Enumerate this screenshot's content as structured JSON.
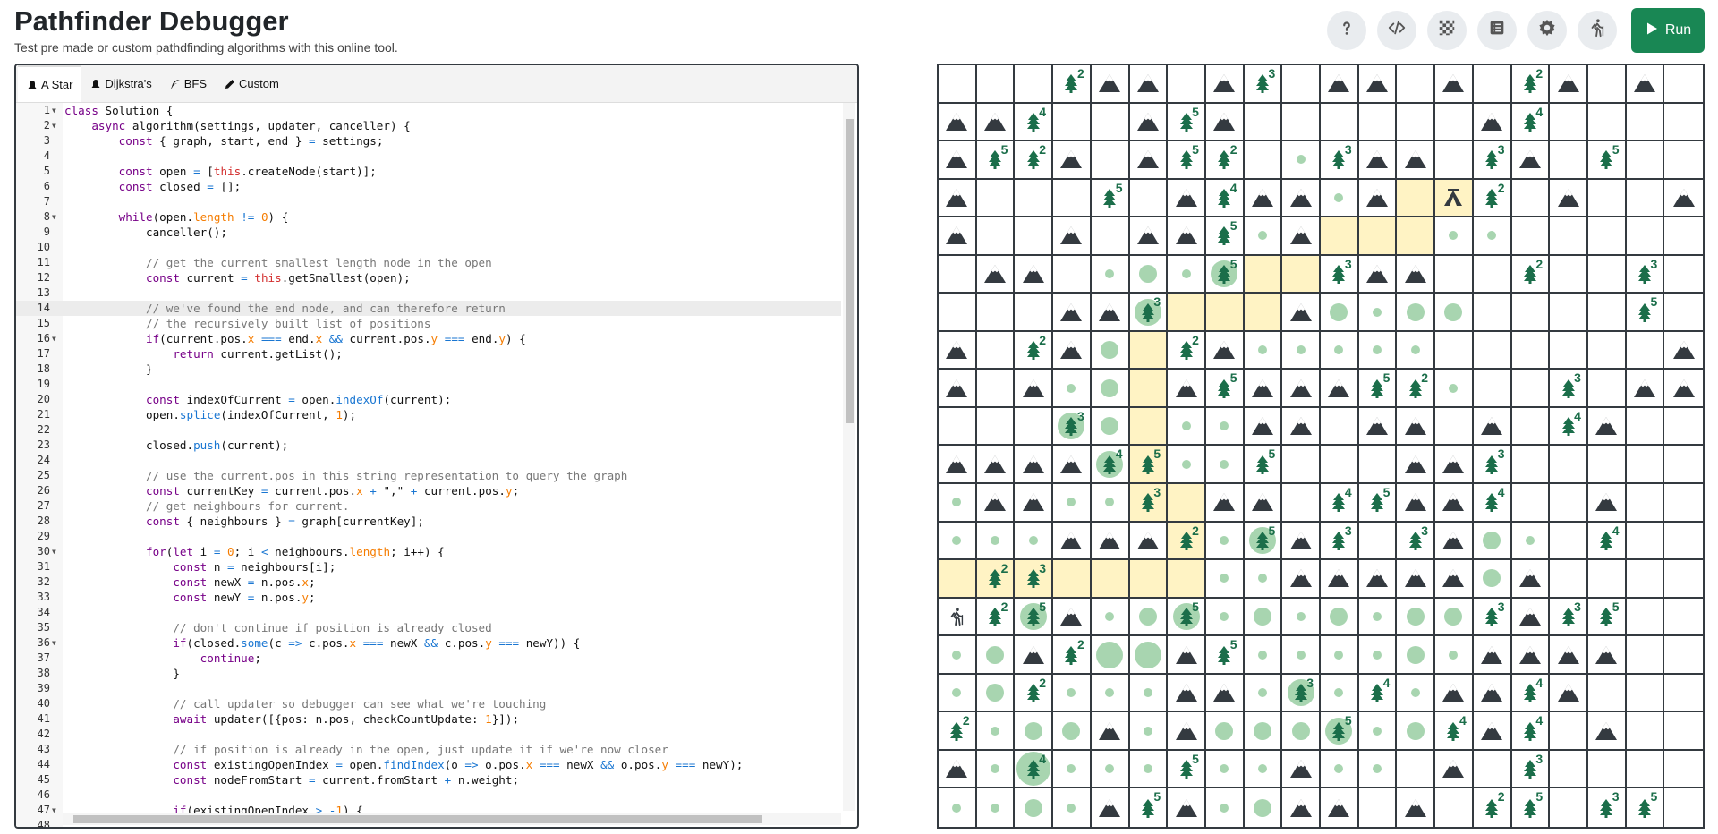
{
  "header": {
    "title": "Pathfinder Debugger",
    "subtitle": "Test pre made or custom pathdfinding algorithms with this online tool."
  },
  "toolbar": {
    "buttons": [
      "help-icon",
      "code-settings-icon",
      "grid-pattern-icon",
      "table-icon",
      "gear-icon",
      "hiker-icon"
    ],
    "run_label": "Run"
  },
  "tabs": [
    {
      "label": "A Star",
      "icon": "bell-icon",
      "active": true
    },
    {
      "label": "Dijkstra's",
      "icon": "bell-icon",
      "active": false
    },
    {
      "label": "BFS",
      "icon": "feather-icon",
      "active": false
    },
    {
      "label": "Custom",
      "icon": "pencil-icon",
      "active": false
    }
  ],
  "editor": {
    "current_line": 14,
    "folded_lines": [
      1,
      2,
      8,
      16,
      30,
      36,
      47
    ],
    "lines": [
      "class Solution {",
      "    async algorithm(settings, updater, canceller) {",
      "        const { graph, start, end } = settings;",
      "",
      "        const open = [this.createNode(start)];",
      "        const closed = [];",
      "",
      "        while(open.length != 0) {",
      "            canceller();",
      "",
      "            // get the current smallest length node in the open",
      "            const current = this.getSmallest(open);",
      "",
      "            // we've found the end node, and can therefore return",
      "            // the recursively built list of positions",
      "            if(current.pos.x === end.x && current.pos.y === end.y) {",
      "                return current.getList();",
      "            }",
      "",
      "            const indexOfCurrent = open.indexOf(current);",
      "            open.splice(indexOfCurrent, 1);",
      "",
      "            closed.push(current);",
      "",
      "            // use the current.pos in this string representation to query the graph",
      "            const currentKey = current.pos.x + \",\" + current.pos.y;",
      "            // get neighbours for current.",
      "            const { neighbours } = graph[currentKey];",
      "",
      "            for(let i = 0; i < neighbours.length; i++) {",
      "                const n = neighbours[i];",
      "                const newX = n.pos.x;",
      "                const newY = n.pos.y;",
      "",
      "                // don't continue if position is already closed",
      "                if(closed.some(c => c.pos.x === newX && c.pos.y === newY)) {",
      "                    continue;",
      "                }",
      "",
      "                // call updater so debugger can see what we're touching",
      "                await updater([{pos: n.pos, checkCountUpdate: 1}]);",
      "",
      "                // if position is already in the open, just update it if we're now closer",
      "                const existingOpenIndex = open.findIndex(o => o.pos.x === newX && o.pos.y === newY);",
      "                const nodeFromStart = current.fromStart + n.weight;",
      "",
      "                if(existingOpenIndex > -1) {",
      ""
    ]
  },
  "grid": {
    "rows": [
      [
        ".",
        ".",
        ".",
        "T2",
        "M",
        "M",
        ".",
        "M",
        "T3",
        ".",
        "M",
        "M",
        ".",
        "M",
        ".",
        "T2",
        "M",
        ".",
        "M",
        "."
      ],
      [
        "M",
        "M",
        "T4",
        ".",
        ".",
        "M",
        "T5",
        "M",
        ".",
        ".",
        ".",
        ".",
        ".",
        ".",
        "M",
        "T4",
        ".",
        ".",
        ".",
        "."
      ],
      [
        "M",
        "T5",
        "T2",
        "M",
        ".",
        "M",
        "T5",
        "T2",
        ".",
        "d",
        "T3",
        "M",
        "M",
        ".",
        "T3",
        "M",
        ".",
        "T5",
        ".",
        "."
      ],
      [
        "M",
        ".",
        ".",
        ".",
        "T5",
        ".",
        "M",
        "T4",
        "M",
        "M",
        "d",
        "M",
        "p",
        "C",
        "T2",
        ".",
        "M",
        ".",
        ".",
        "M"
      ],
      [
        "M",
        ".",
        ".",
        "M",
        ".",
        "M",
        "M",
        "T5",
        "d",
        "M",
        "p",
        "p",
        "p",
        "d",
        "d",
        ".",
        ".",
        ".",
        ".",
        "."
      ],
      [
        ".",
        "M",
        "M",
        ".",
        "d",
        "D",
        "d",
        "Db5",
        "p",
        "p",
        "T3",
        "M",
        "M",
        ".",
        ".",
        "T2",
        ".",
        ".",
        "T3",
        "."
      ],
      [
        ".",
        ".",
        ".",
        "M",
        "M",
        "Db3",
        "p",
        "p",
        "p",
        "M",
        "D",
        "d",
        "D",
        "D",
        ".",
        ".",
        ".",
        ".",
        "T5",
        "."
      ],
      [
        "M",
        ".",
        "T2",
        "M",
        "D",
        "p",
        "T2",
        "M",
        "d",
        "d",
        "d",
        "d",
        "d",
        ".",
        ".",
        ".",
        ".",
        ".",
        ".",
        "M"
      ],
      [
        "M",
        ".",
        "M",
        "d",
        "D",
        "p",
        "M",
        "T5",
        "M",
        "M",
        "M",
        "T5",
        "T2",
        "d",
        ".",
        ".",
        "T3",
        ".",
        "M",
        "M"
      ],
      [
        ".",
        ".",
        ".",
        "Db3",
        "D",
        "p",
        "d",
        "d",
        "M",
        "M",
        ".",
        "M",
        "M",
        ".",
        "M",
        ".",
        "T4",
        "M",
        ".",
        "."
      ],
      [
        "M",
        "M",
        "M",
        "M",
        "Db4",
        "Tp5",
        "d",
        "d",
        "T5",
        ".",
        ".",
        ".",
        "M",
        "M",
        "T3",
        ".",
        ".",
        ".",
        ".",
        "."
      ],
      [
        "d",
        "M",
        "M",
        "d",
        "d",
        "Tp3",
        "p",
        "M",
        "M",
        ".",
        "T4",
        "T5",
        "M",
        "M",
        "T4",
        ".",
        ".",
        "M",
        ".",
        "."
      ],
      [
        "d",
        "d",
        "d",
        "M",
        "M",
        "M",
        "Tp2",
        "d",
        "Db5",
        "M",
        "T3",
        ".",
        "T3",
        "M",
        "D",
        "d",
        ".",
        "T4",
        ".",
        "."
      ],
      [
        "p",
        "Tp2",
        "Tp3",
        "p",
        "p",
        "p",
        "p",
        "d",
        "d",
        "M",
        "M",
        "M",
        "M",
        "M",
        "D",
        "M",
        ".",
        ".",
        ".",
        "."
      ],
      [
        "S",
        "T2",
        "Db5",
        "M",
        "d",
        "D",
        "Db5",
        "d",
        "D",
        "d",
        "D",
        "d",
        "D",
        "D",
        "T3",
        "M",
        "T3",
        "T5",
        ".",
        "."
      ],
      [
        "d",
        "D",
        "M",
        "T2",
        "Dl",
        "Dl",
        "M",
        "T5",
        "d",
        "d",
        "d",
        "d",
        "D",
        "d",
        "M",
        "M",
        "M",
        "M",
        ".",
        "."
      ],
      [
        "d",
        "D",
        "T2",
        "d",
        "d",
        "d",
        "M",
        "M",
        "d",
        "Db3",
        "d",
        "T4",
        "d",
        "M",
        "M",
        "T4",
        "M",
        ".",
        ".",
        "."
      ],
      [
        "T2",
        "d",
        "D",
        "D",
        "M",
        "d",
        "M",
        "D",
        "D",
        "D",
        "Db5",
        "d",
        "D",
        "T4",
        "M",
        "T4",
        ".",
        "M",
        ".",
        "."
      ],
      [
        "M",
        "d",
        "Dbl4",
        "d",
        "d",
        "d",
        "T5",
        "d",
        "d",
        "M",
        "d",
        "d",
        ".",
        "M",
        ".",
        "T3",
        ".",
        ".",
        ".",
        "."
      ],
      [
        "d",
        "d",
        "D",
        "d",
        "M",
        "T5",
        "M",
        "d",
        "D",
        "M",
        "M",
        ".",
        "M",
        ".",
        "T2",
        "T5",
        ".",
        "T3",
        "T5",
        "."
      ]
    ]
  }
}
